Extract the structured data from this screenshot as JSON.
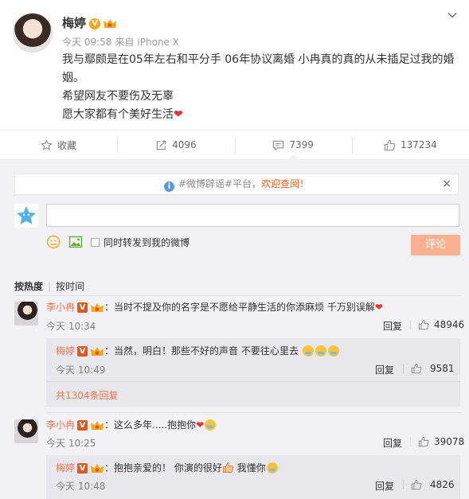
{
  "post": {
    "author": "梅婷",
    "time": "今天 09:58",
    "source_prefix": "来自",
    "source": "iPhone X",
    "lines": [
      "我与鄢颇是在05年左右和平分手  06年协议离婚 小冉真的真的从未插足过我的婚",
      "姻。",
      "希望网友不要伤及无辜",
      "愿大家都有个美好生活"
    ],
    "heart": "❤"
  },
  "actions": {
    "favorite": "收藏",
    "repost": "4096",
    "comment": "7399",
    "like": "137234"
  },
  "notice": {
    "prefix": "#微博辟谣#平台，",
    "link": "欢迎查阅！",
    "close": "×"
  },
  "composer": {
    "value": "",
    "placeholder": "",
    "repost_label": "同时转发到我的微博",
    "submit": "评论"
  },
  "sort": {
    "hot": "按热度",
    "time": "按时间"
  },
  "comments": [
    {
      "user": "李小冉",
      "text": "：当时不提及你的名字是不愿给平静生活的你添麻烦 千万别误解",
      "time": "今天 10:34",
      "reply": "回复",
      "likes": "48946",
      "sub": {
        "user": "梅婷",
        "text": "：当然，明白！那些不好的声音 不要往心里去",
        "time": "今天 10:49",
        "reply": "回复",
        "likes": "9581",
        "more": "共1304条回复"
      }
    },
    {
      "user": "李小冉",
      "text": "：这么多年.....抱抱你",
      "time": "今天 10:25",
      "reply": "回复",
      "likes": "39078",
      "sub": {
        "user": "梅婷",
        "text_a": "：抱抱亲爱的！ 你演的很好",
        "text_b": " 我懂你",
        "time": "今天 10:48",
        "reply": "回复",
        "likes": "4826"
      }
    }
  ],
  "colors": {
    "accent": "#eb7350",
    "submit_bg": "#f9b191",
    "panel_bg": "#f2f2f5",
    "heart": "#e8322b"
  }
}
